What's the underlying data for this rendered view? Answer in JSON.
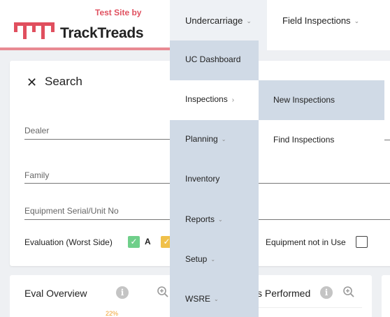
{
  "header": {
    "test_site": "Test Site by",
    "logo_text": "TrackTreads",
    "nav": [
      {
        "label": "Undercarriage"
      },
      {
        "label": "Field Inspections"
      }
    ]
  },
  "colors": {
    "brand_red": "#e04f5e",
    "menu_bg": "#d0dae6",
    "check_green": "#6fcf8a",
    "check_yellow": "#f0c04a"
  },
  "search": {
    "title": "Search",
    "fields": [
      {
        "label": "Dealer",
        "value": ""
      },
      {
        "label": "Family",
        "value": ""
      },
      {
        "label": "Equipment Serial/Unit No",
        "value": ""
      }
    ],
    "evaluation_label": "Evaluation (Worst Side)",
    "grade_a_label": "A",
    "not_in_use_label": "Equipment not in Use"
  },
  "cards": {
    "eval_overview": {
      "title": "Eval Overview",
      "pct_label": "22%"
    },
    "performed": {
      "title": "s Performed"
    }
  },
  "menu": {
    "items": [
      {
        "label": "UC Dashboard"
      },
      {
        "label": "Inspections"
      },
      {
        "label": "Planning"
      },
      {
        "label": "Inventory"
      },
      {
        "label": "Reports"
      },
      {
        "label": "Setup"
      },
      {
        "label": "WSRE"
      }
    ],
    "submenu": [
      {
        "label": "New Inspections"
      },
      {
        "label": "Find Inspections"
      }
    ]
  }
}
